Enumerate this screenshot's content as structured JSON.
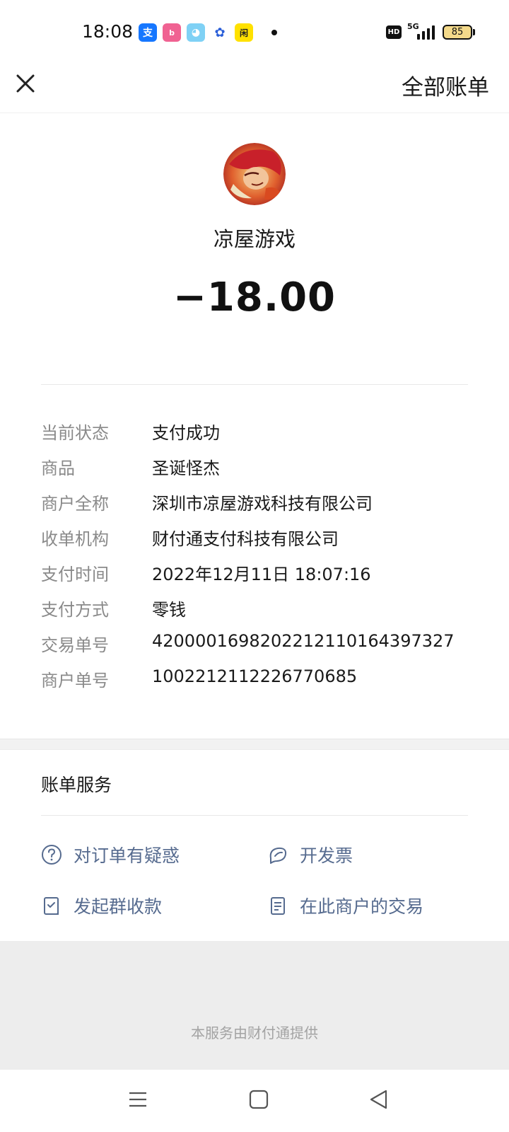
{
  "status_bar": {
    "time": "18:08",
    "apps": [
      {
        "icon": "alipay-icon",
        "glyph": "支",
        "color": "#1677ff"
      },
      {
        "icon": "bilibili-icon",
        "glyph": "b",
        "color": "#f06292"
      },
      {
        "icon": "chat-app-icon",
        "glyph": "◕",
        "color": "#7fd1f5"
      },
      {
        "icon": "baidu-icon",
        "glyph": "✿",
        "color": "#2b5fd9"
      },
      {
        "icon": "xianyu-icon",
        "glyph": "闲",
        "color": "#ffe100"
      }
    ],
    "hd": "HD",
    "network": "5G",
    "battery": "85"
  },
  "header": {
    "close_icon": "close-icon",
    "all_bills_label": "全部账单"
  },
  "merchant": {
    "name": "凉屋游戏",
    "amount": "−18.00"
  },
  "details": [
    {
      "label": "当前状态",
      "value": "支付成功"
    },
    {
      "label": "商品",
      "value": "圣诞怪杰"
    },
    {
      "label": "商户全称",
      "value": "深圳市凉屋游戏科技有限公司"
    },
    {
      "label": "收单机构",
      "value": "财付通支付科技有限公司"
    },
    {
      "label": "支付时间",
      "value": "2022年12月11日 18:07:16"
    },
    {
      "label": "支付方式",
      "value": "零钱"
    },
    {
      "label": "交易单号",
      "value": "4200001698202212110164397327"
    },
    {
      "label": "商户单号",
      "value": "1002212112226770685"
    }
  ],
  "services": {
    "title": "账单服务",
    "items": [
      {
        "icon": "question-circle-icon",
        "label": "对订单有疑惑"
      },
      {
        "icon": "invoice-icon",
        "label": "开发票"
      },
      {
        "icon": "group-collect-icon",
        "label": "发起群收款"
      },
      {
        "icon": "document-icon",
        "label": "在此商户的交易"
      }
    ]
  },
  "footer": {
    "provider_text": "本服务由财付通提供"
  },
  "system_nav": {
    "menu_icon": "menu-icon",
    "home_icon": "home-square-icon",
    "back_icon": "back-triangle-icon"
  },
  "colors": {
    "link": "#566b8f",
    "label": "#8a8a8a",
    "footer_bg": "#ededed"
  }
}
